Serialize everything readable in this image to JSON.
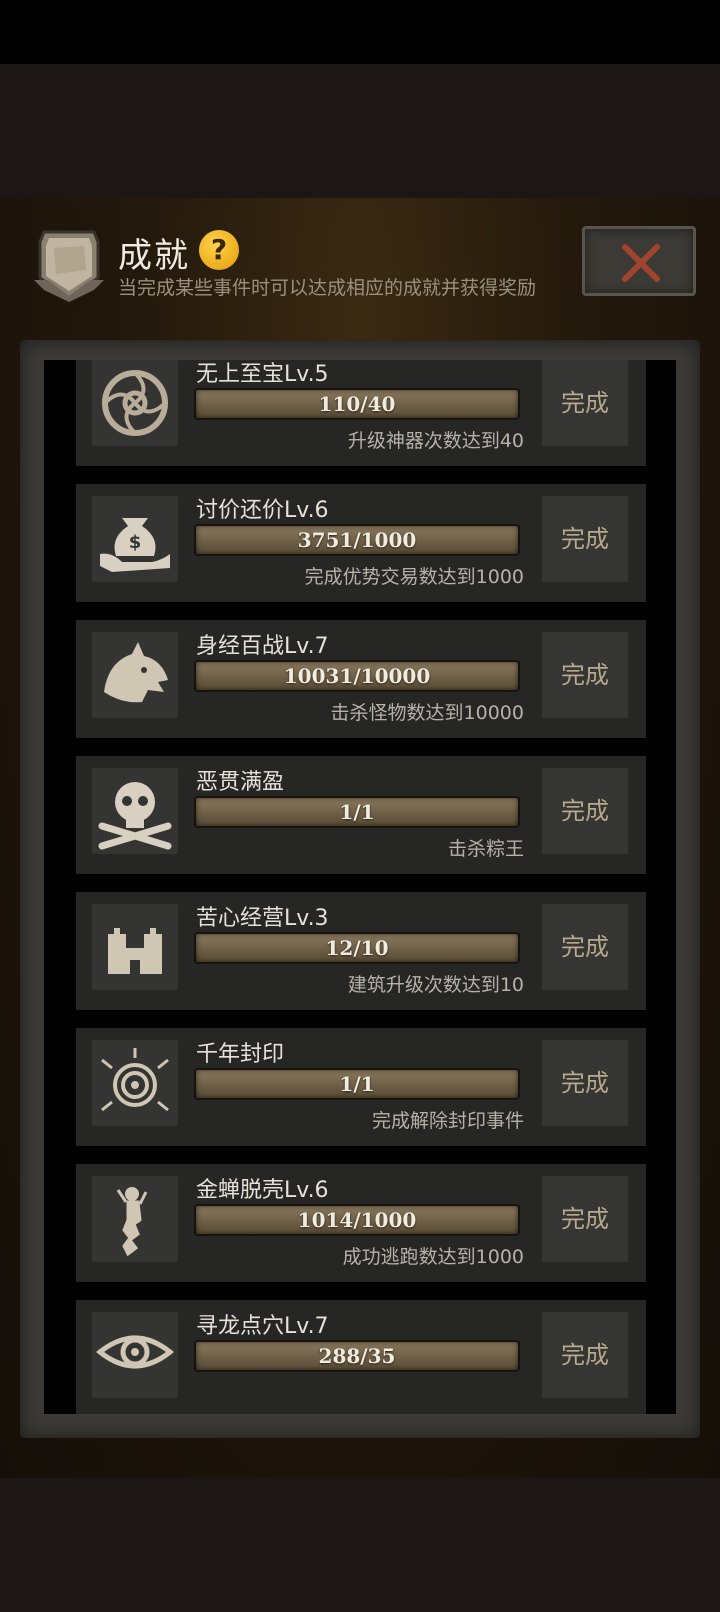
{
  "header": {
    "title": "成就",
    "help_symbol": "?",
    "subtitle": "当完成某些事件时可以达成相应的成就并获得奖励",
    "emblem_icon": "shield-emblem-icon",
    "close_icon": "close-x-icon"
  },
  "colors": {
    "accent_close": "#a0432f",
    "help_badge": "#f2b01e",
    "progress_bar": "#7a6a50"
  },
  "achievements": [
    {
      "name": "无上至宝Lv.5",
      "progress_text": "110/40",
      "progress": 1.0,
      "desc": "升级神器次数达到40",
      "button": "完成",
      "icon": "spiral-rune-icon"
    },
    {
      "name": "讨价还价Lv.6",
      "progress_text": "3751/1000",
      "progress": 1.0,
      "desc": "完成优势交易数达到1000",
      "button": "完成",
      "icon": "money-bag-hand-icon"
    },
    {
      "name": "身经百战Lv.7",
      "progress_text": "10031/10000",
      "progress": 1.0,
      "desc": "击杀怪物数达到10000",
      "button": "完成",
      "icon": "wolf-head-icon"
    },
    {
      "name": "恶贯满盈",
      "progress_text": "1/1",
      "progress": 1.0,
      "desc": "击杀粽王",
      "button": "完成",
      "icon": "skull-crossbones-icon"
    },
    {
      "name": "苦心经营Lv.3",
      "progress_text": "12/10",
      "progress": 1.0,
      "desc": "建筑升级次数达到10",
      "button": "完成",
      "icon": "castle-icon"
    },
    {
      "name": "千年封印",
      "progress_text": "1/1",
      "progress": 1.0,
      "desc": "完成解除封印事件",
      "button": "完成",
      "icon": "seal-spiral-icon"
    },
    {
      "name": "金蝉脱壳Lv.6",
      "progress_text": "1014/1000",
      "progress": 1.0,
      "desc": "成功逃跑数达到1000",
      "button": "完成",
      "icon": "escaping-figure-icon"
    },
    {
      "name": "寻龙点穴Lv.7",
      "progress_text": "288/35",
      "progress": 1.0,
      "desc": "",
      "button": "完成",
      "icon": "dragon-eye-icon"
    }
  ]
}
